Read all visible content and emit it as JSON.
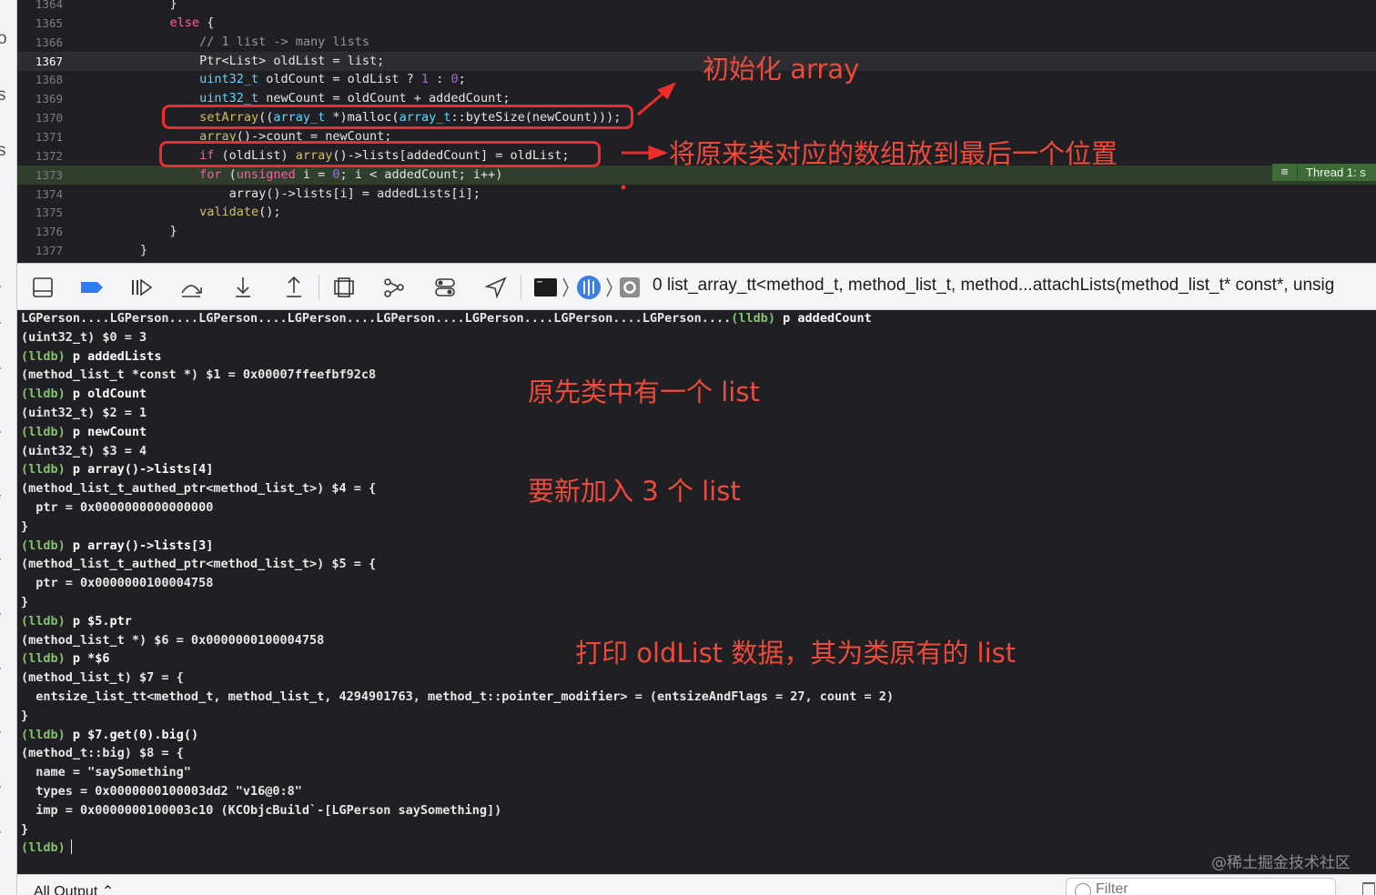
{
  "navigator_glyphs": [
    "o",
    "s",
    "s",
    ".",
    ".",
    ".",
    ".",
    ".",
    ".",
    ".",
    ".",
    ".",
    ".",
    "."
  ],
  "editor": {
    "lines": [
      {
        "num": "1364",
        "indent": 6,
        "tokens": [
          {
            "t": "}",
            "c": "p"
          }
        ]
      },
      {
        "num": "1365",
        "indent": 6,
        "tokens": [
          {
            "t": "else",
            "c": "k"
          },
          {
            "t": " {",
            "c": "p"
          }
        ]
      },
      {
        "num": "1366",
        "indent": 8,
        "tokens": [
          {
            "t": "// 1 list -> many lists",
            "c": "c"
          }
        ]
      },
      {
        "num": "1367",
        "indent": 8,
        "current": true,
        "tokens": [
          {
            "t": "Ptr<List> oldList = list;",
            "c": "p"
          }
        ]
      },
      {
        "num": "1368",
        "indent": 8,
        "tokens": [
          {
            "t": "uint32_t",
            "c": "t"
          },
          {
            "t": " oldCount = oldList ? ",
            "c": "p"
          },
          {
            "t": "1",
            "c": "f"
          },
          {
            "t": " : ",
            "c": "p"
          },
          {
            "t": "0",
            "c": "f"
          },
          {
            "t": ";",
            "c": "p"
          }
        ]
      },
      {
        "num": "1369",
        "indent": 8,
        "tokens": [
          {
            "t": "uint32_t",
            "c": "t"
          },
          {
            "t": " newCount = oldCount + addedCount;",
            "c": "p"
          }
        ]
      },
      {
        "num": "1370",
        "indent": 8,
        "tokens": [
          {
            "t": "setArray",
            "c": "n"
          },
          {
            "t": "((",
            "c": "p"
          },
          {
            "t": "array_t",
            "c": "t"
          },
          {
            "t": " *)malloc(",
            "c": "p"
          },
          {
            "t": "array_t",
            "c": "t"
          },
          {
            "t": "::byteSize(newCount)));",
            "c": "p"
          }
        ]
      },
      {
        "num": "1371",
        "indent": 8,
        "tokens": [
          {
            "t": "array",
            "c": "n"
          },
          {
            "t": "()->count = newCount;",
            "c": "p"
          }
        ]
      },
      {
        "num": "1372",
        "indent": 8,
        "tokens": [
          {
            "t": "if",
            "c": "k"
          },
          {
            "t": " (oldList) ",
            "c": "p"
          },
          {
            "t": "array",
            "c": "n"
          },
          {
            "t": "()->lists[addedCount] = oldList;",
            "c": "p"
          }
        ]
      },
      {
        "num": "1373",
        "indent": 8,
        "thread": true,
        "tokens": [
          {
            "t": "for",
            "c": "k"
          },
          {
            "t": " (",
            "c": "p"
          },
          {
            "t": "unsigned",
            "c": "k"
          },
          {
            "t": " i = ",
            "c": "p"
          },
          {
            "t": "0",
            "c": "f"
          },
          {
            "t": "; i < addedCount; i++)",
            "c": "p"
          }
        ]
      },
      {
        "num": "1374",
        "indent": 10,
        "tokens": [
          {
            "t": "array()->lists[i] = addedLists[i];",
            "c": "p"
          }
        ]
      },
      {
        "num": "1375",
        "indent": 8,
        "tokens": [
          {
            "t": "validate",
            "c": "n"
          },
          {
            "t": "();",
            "c": "p"
          }
        ]
      },
      {
        "num": "1376",
        "indent": 6,
        "tokens": [
          {
            "t": "}",
            "c": "p"
          }
        ]
      },
      {
        "num": "1377",
        "indent": 4,
        "tokens": [
          {
            "t": "}",
            "c": "p"
          }
        ]
      }
    ],
    "thread_badge": {
      "icon": "≡",
      "text": "Thread 1: s"
    }
  },
  "annotations": {
    "init_array": "初始化 array",
    "move_old": "将原来类对应的数组放到最后一个位置",
    "one_list": "原先类中有一个 list",
    "add_three": "要新加入 3 个 list",
    "print_old": "打印 oldList 数据，其为类原有的 list"
  },
  "toolbar": {
    "buttons": [
      {
        "icon": "hide-debug-area-icon"
      },
      {
        "icon": "breakpoints-toggle-icon"
      },
      {
        "icon": "continue-icon"
      },
      {
        "icon": "step-over-icon"
      },
      {
        "icon": "step-into-icon"
      },
      {
        "icon": "step-out-icon"
      },
      {
        "icon": "view-debugger-icon"
      },
      {
        "icon": "memory-graph-icon"
      },
      {
        "icon": "environment-overrides-icon"
      },
      {
        "icon": "simulate-location-icon"
      }
    ],
    "breadcrumb": "0 list_array_tt<method_t, method_list_t, method...attachLists(method_list_t* const*, unsig"
  },
  "console": {
    "lines": [
      {
        "out": "LGPerson....LGPerson....LGPerson....LGPerson....LGPerson....LGPerson....LGPerson....LGPerson....",
        "prompt": "(lldb)",
        "cmd": " p addedCount"
      },
      {
        "out": "(uint32_t) $0 = 3"
      },
      {
        "prompt": "(lldb)",
        "cmd": " p addedLists"
      },
      {
        "out": "(method_list_t *const *) $1 = 0x00007ffeefbf92c8"
      },
      {
        "prompt": "(lldb)",
        "cmd": " p oldCount"
      },
      {
        "out": "(uint32_t) $2 = 1"
      },
      {
        "prompt": "(lldb)",
        "cmd": " p newCount"
      },
      {
        "out": "(uint32_t) $3 = 4"
      },
      {
        "prompt": "(lldb)",
        "cmd": " p array()->lists[4]"
      },
      {
        "out": "(method_list_t_authed_ptr<method_list_t>) $4 = {"
      },
      {
        "out": "  ptr = 0x0000000000000000"
      },
      {
        "out": "}"
      },
      {
        "prompt": "(lldb)",
        "cmd": " p array()->lists[3]"
      },
      {
        "out": "(method_list_t_authed_ptr<method_list_t>) $5 = {"
      },
      {
        "out": "  ptr = 0x0000000100004758"
      },
      {
        "out": "}"
      },
      {
        "prompt": "(lldb)",
        "cmd": " p $5.ptr"
      },
      {
        "out": "(method_list_t *) $6 = 0x0000000100004758"
      },
      {
        "prompt": "(lldb)",
        "cmd": " p *$6"
      },
      {
        "out": "(method_list_t) $7 = {"
      },
      {
        "out": "  entsize_list_tt<method_t, method_list_t, 4294901763, method_t::pointer_modifier> = (entsizeAndFlags = 27, count = 2)"
      },
      {
        "out": "}"
      },
      {
        "prompt": "(lldb)",
        "cmd": " p $7.get(0).big()"
      },
      {
        "out": "(method_t::big) $8 = {"
      },
      {
        "out": "  name = \"saySomething\""
      },
      {
        "out": "  types = 0x0000000100003dd2 \"v16@0:8\""
      },
      {
        "out": "  imp = 0x0000000100003c10 (KCObjcBuild`-[LGPerson saySomething])"
      },
      {
        "out": "}"
      },
      {
        "prompt": "(lldb)",
        "cmd": "",
        "caret": true
      }
    ]
  },
  "watermark": "@稀土掘金技术社区",
  "bottombar": {
    "output_label": "All Output ⌃",
    "filter_placeholder": "Filter"
  },
  "colors": {
    "annotation_red": "#ec4b3a",
    "prompt_green": "#83c36b",
    "editor_bg": "#1f1f24"
  }
}
